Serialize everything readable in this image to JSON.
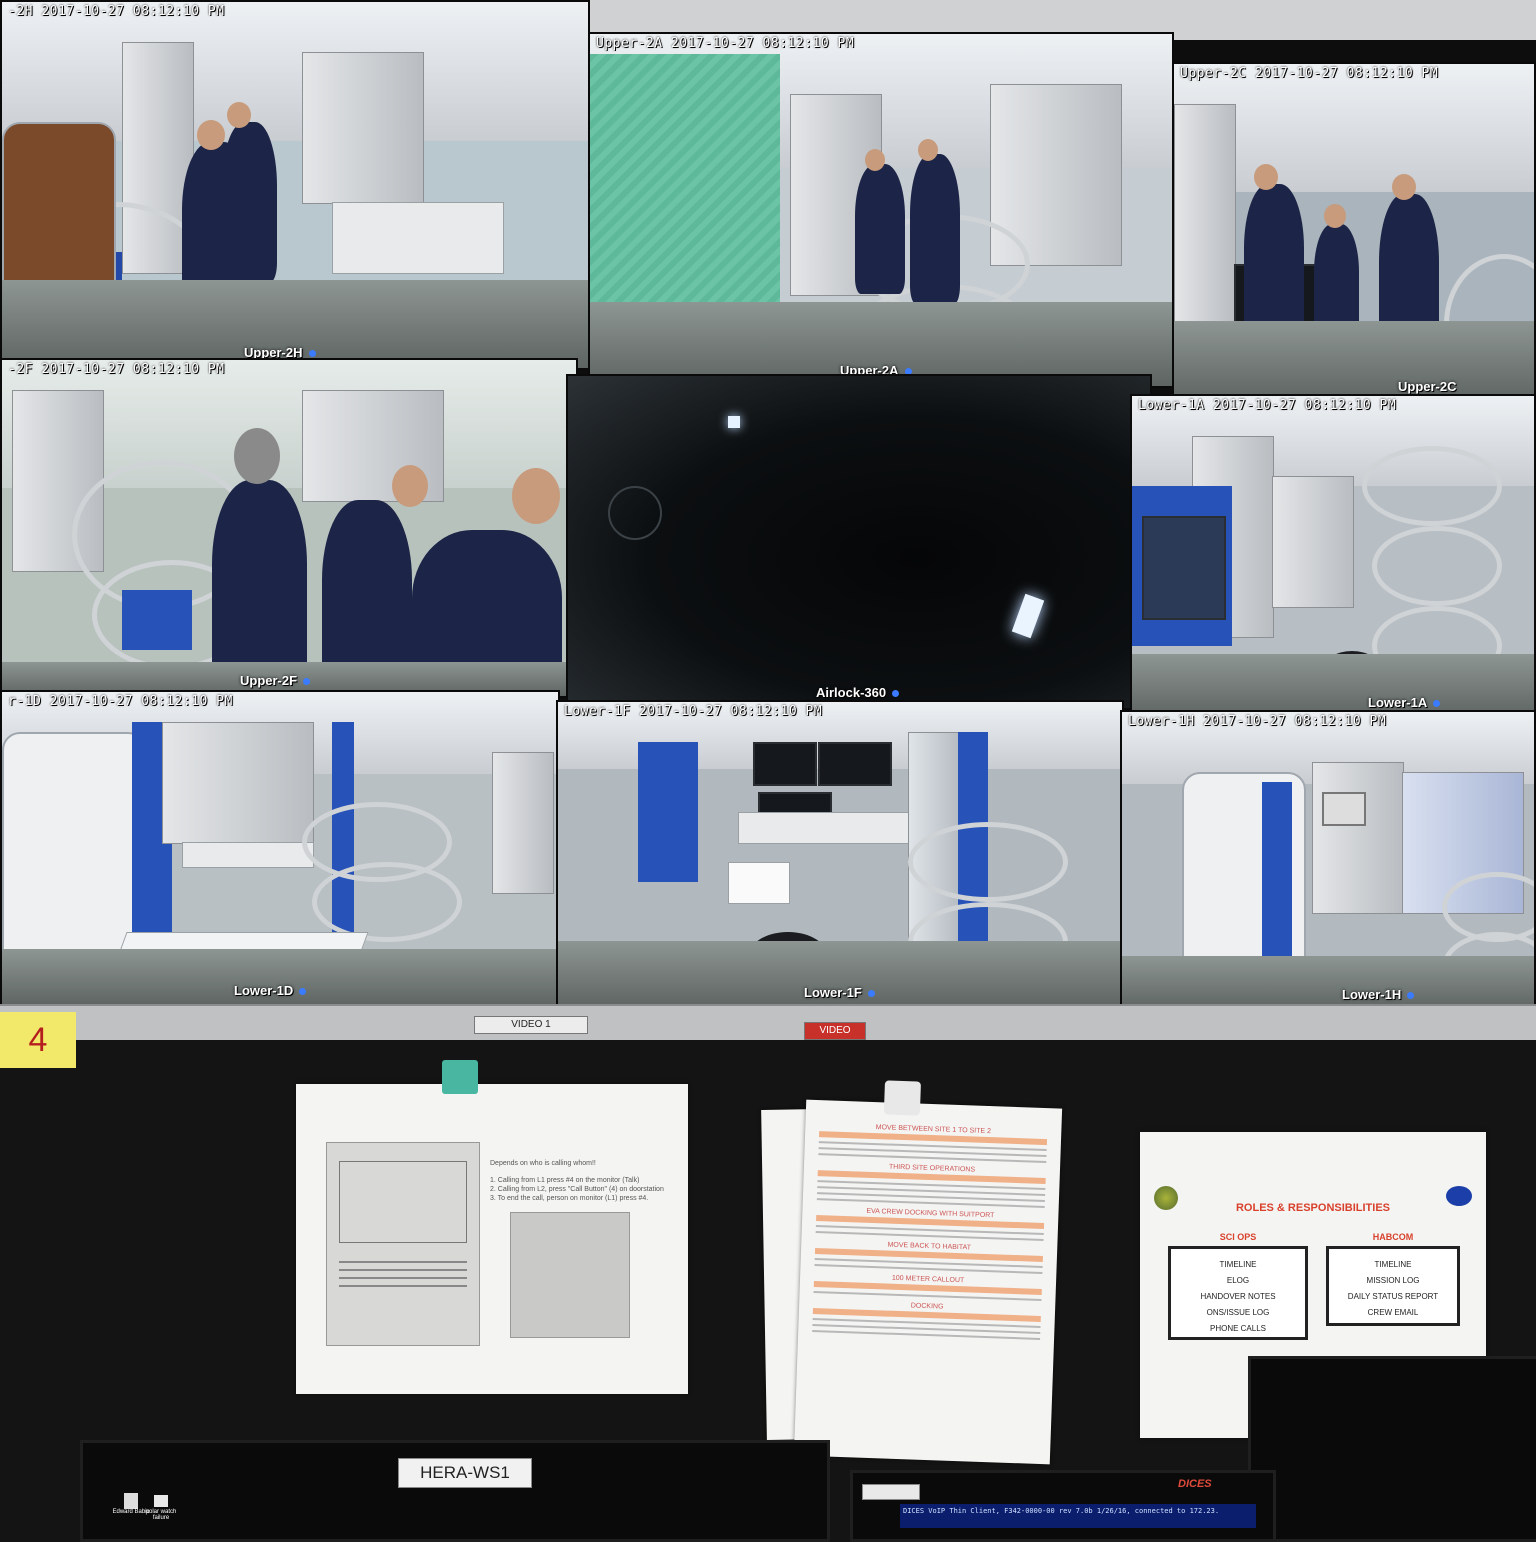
{
  "monitor": {
    "timestamp": "2017-10-27 08:12:10 PM",
    "feeds": [
      {
        "id": "upper-2h",
        "ts_prefix": "-2H",
        "label": "Upper-2H"
      },
      {
        "id": "upper-2a",
        "ts_prefix": "Upper-2A",
        "label": "Upper-2A"
      },
      {
        "id": "upper-2c",
        "ts_prefix": "Upper-2C",
        "label": "Upper-2C"
      },
      {
        "id": "upper-2f",
        "ts_prefix": "-2F",
        "label": "Upper-2F"
      },
      {
        "id": "airlock-360",
        "ts_prefix": "",
        "label": "Airlock-360"
      },
      {
        "id": "lower-1a",
        "ts_prefix": "Lower-1A",
        "label": "Lower-1A"
      },
      {
        "id": "lower-1d",
        "ts_prefix": "r-1D",
        "label": "Lower-1D"
      },
      {
        "id": "lower-1f",
        "ts_prefix": "Lower-1F",
        "label": "Lower-1F"
      },
      {
        "id": "lower-1h",
        "ts_prefix": "Lower-1H",
        "label": "Lower-1H"
      }
    ],
    "tape_left": "VIDEO 1",
    "tape_right": "VIDEO"
  },
  "sticky_note": "4",
  "intercom_sheet": {
    "heading": "Depends on who is calling whom!!",
    "steps": [
      "1.  Calling from L1 press #4 on the monitor (Talk)",
      "2.  Calling from L2, press \"Call Button\" (4) on doorstation",
      "3.  To end the call, person on monitor (L1) press #4."
    ]
  },
  "checklist_sheet": {
    "sections": [
      "MOVE BETWEEN SITE 1 TO SITE 2",
      "THIRD SITE OPERATIONS",
      "EVA CREW DOCKING WITH SUITPORT",
      "MOVE BACK TO HABITAT",
      "100 METER CALLOUT",
      "DOCKING"
    ]
  },
  "roles_sheet": {
    "title": "ROLES & RESPONSIBILITIES",
    "sci_ops": {
      "heading": "SCI OPS",
      "items": [
        "TIMELINE",
        "ELOG",
        "HANDOVER NOTES",
        "ONS/ISSUE LOG",
        "PHONE CALLS"
      ]
    },
    "habcom": {
      "heading": "HABCOM",
      "items": [
        "TIMELINE",
        "MISSION LOG",
        "DAILY STATUS REPORT",
        "CREW EMAIL"
      ]
    }
  },
  "workstation": {
    "label": "HERA-WS1",
    "desktop_icons": [
      "Edward Babic",
      "polar watch failure"
    ],
    "voip_text": "DICES VoIP Thin Client, F342-0000-00 rev 7.0b 1/26/16, connected to 172.23.",
    "dices_badge": "DICES"
  }
}
